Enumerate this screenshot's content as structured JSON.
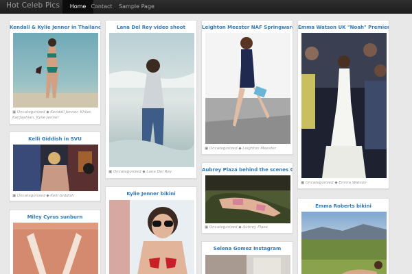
{
  "site": {
    "brand": "Hot Celeb Pics",
    "nav": [
      "Home",
      "Contact",
      "Sample Page"
    ]
  },
  "posts": [
    {
      "title": "Kendall & Kylie Jenner in Thailand",
      "category": "Uncategorized",
      "tags": "Kendall Jenner, Khloe Kardashian, Kylie Jenner"
    },
    {
      "title": "Kelli Giddish in SVU",
      "category": "Uncategorized",
      "tags": "Kelli Giddish"
    },
    {
      "title": "Miley Cyrus sunburn"
    },
    {
      "title": "Lana Del Rey video shoot",
      "category": "Uncategorized",
      "tags": "Lana Del Rey"
    },
    {
      "title": "Kylie Jenner bikini"
    },
    {
      "title": "Leighton Meester NAF Springware",
      "category": "Uncategorized",
      "tags": "Leighton Meester"
    },
    {
      "title": "Aubrey Plaza behind the scenes GQ",
      "category": "Uncategorized",
      "tags": "Aubrey Plaza"
    },
    {
      "title": "Selena Gomez Instagram"
    },
    {
      "title": "Emma Watson UK \"Noah\" Premier",
      "category": "Uncategorized",
      "tags": "Emma Watson"
    },
    {
      "title": "Emma Roberts bikini"
    }
  ],
  "colors": {
    "title": "#3178b8",
    "navbar": "#222222",
    "active_nav": "#0c0c0c",
    "background": "#e8e8e8"
  }
}
